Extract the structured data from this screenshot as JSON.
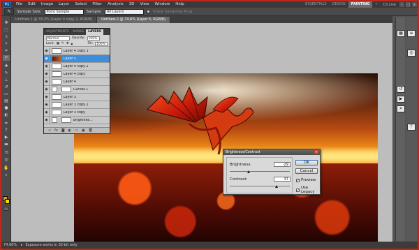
{
  "menubar": {
    "logo": "Ps",
    "items": [
      "File",
      "Edit",
      "Image",
      "Layer",
      "Select",
      "Filter",
      "Analysis",
      "3D",
      "View",
      "Window",
      "Help"
    ],
    "workspaces": [
      "ESSENTIALS",
      "DESIGN",
      "PAINTING"
    ],
    "active_workspace": "PAINTING",
    "cs_live": "CS Live"
  },
  "options": {
    "sample_size_label": "Sample Size:",
    "sample_size_value": "Point Sample",
    "sample_label": "Sample:",
    "sample_value": "All Layers",
    "ring_label": "Show Sampling Ring"
  },
  "tabs": [
    {
      "label": "Untitled-1 @ 33.3% (Layer 4 copy 2, RGB/8)"
    },
    {
      "label": "Untitled-2 @ 74.6% (Layer 5, RGB/8)"
    }
  ],
  "layers_panel": {
    "tabs": [
      "ADJUSTMENTS",
      "MASKS",
      "LAYERS"
    ],
    "active_tab": "LAYERS",
    "blend_mode": "Normal",
    "opacity_label": "Opacity:",
    "opacity_value": "100%",
    "lock_label": "Lock:",
    "fill_label": "Fill:",
    "fill_value": "100%",
    "layers": [
      {
        "name": "Layer 4 copy 3",
        "kind": "pixel"
      },
      {
        "name": "Layer 5",
        "kind": "pixel",
        "selected": true
      },
      {
        "name": "Layer 4 copy 2",
        "kind": "pixel"
      },
      {
        "name": "Layer 4 copy",
        "kind": "pixel"
      },
      {
        "name": "Layer 4",
        "kind": "pixel"
      },
      {
        "name": "Curves 1",
        "kind": "adjustment"
      },
      {
        "name": "Layer 3",
        "kind": "pixel"
      },
      {
        "name": "Layer 3 copy 2",
        "kind": "pixel"
      },
      {
        "name": "Layer 3 copy",
        "kind": "pixel"
      },
      {
        "name": "Brightnes...",
        "kind": "adjustment"
      }
    ]
  },
  "dialog": {
    "title": "Brightness/Contrast",
    "brightness_label": "Brightness:",
    "brightness_value": "-29",
    "contrast_label": "Contrast:",
    "contrast_value": "37",
    "ok_label": "OK",
    "cancel_label": "Cancel",
    "preview_label": "Preview",
    "preview_checked": true,
    "legacy_label": "Use Legacy",
    "legacy_checked": true
  },
  "status": {
    "zoom": "74.60%",
    "message": "Exposure works in 32-bit only"
  },
  "colors": {
    "foreground": "#e79a12",
    "background": "#f5d800",
    "selection": "#3c8ddb",
    "frame": "#c0281e"
  }
}
